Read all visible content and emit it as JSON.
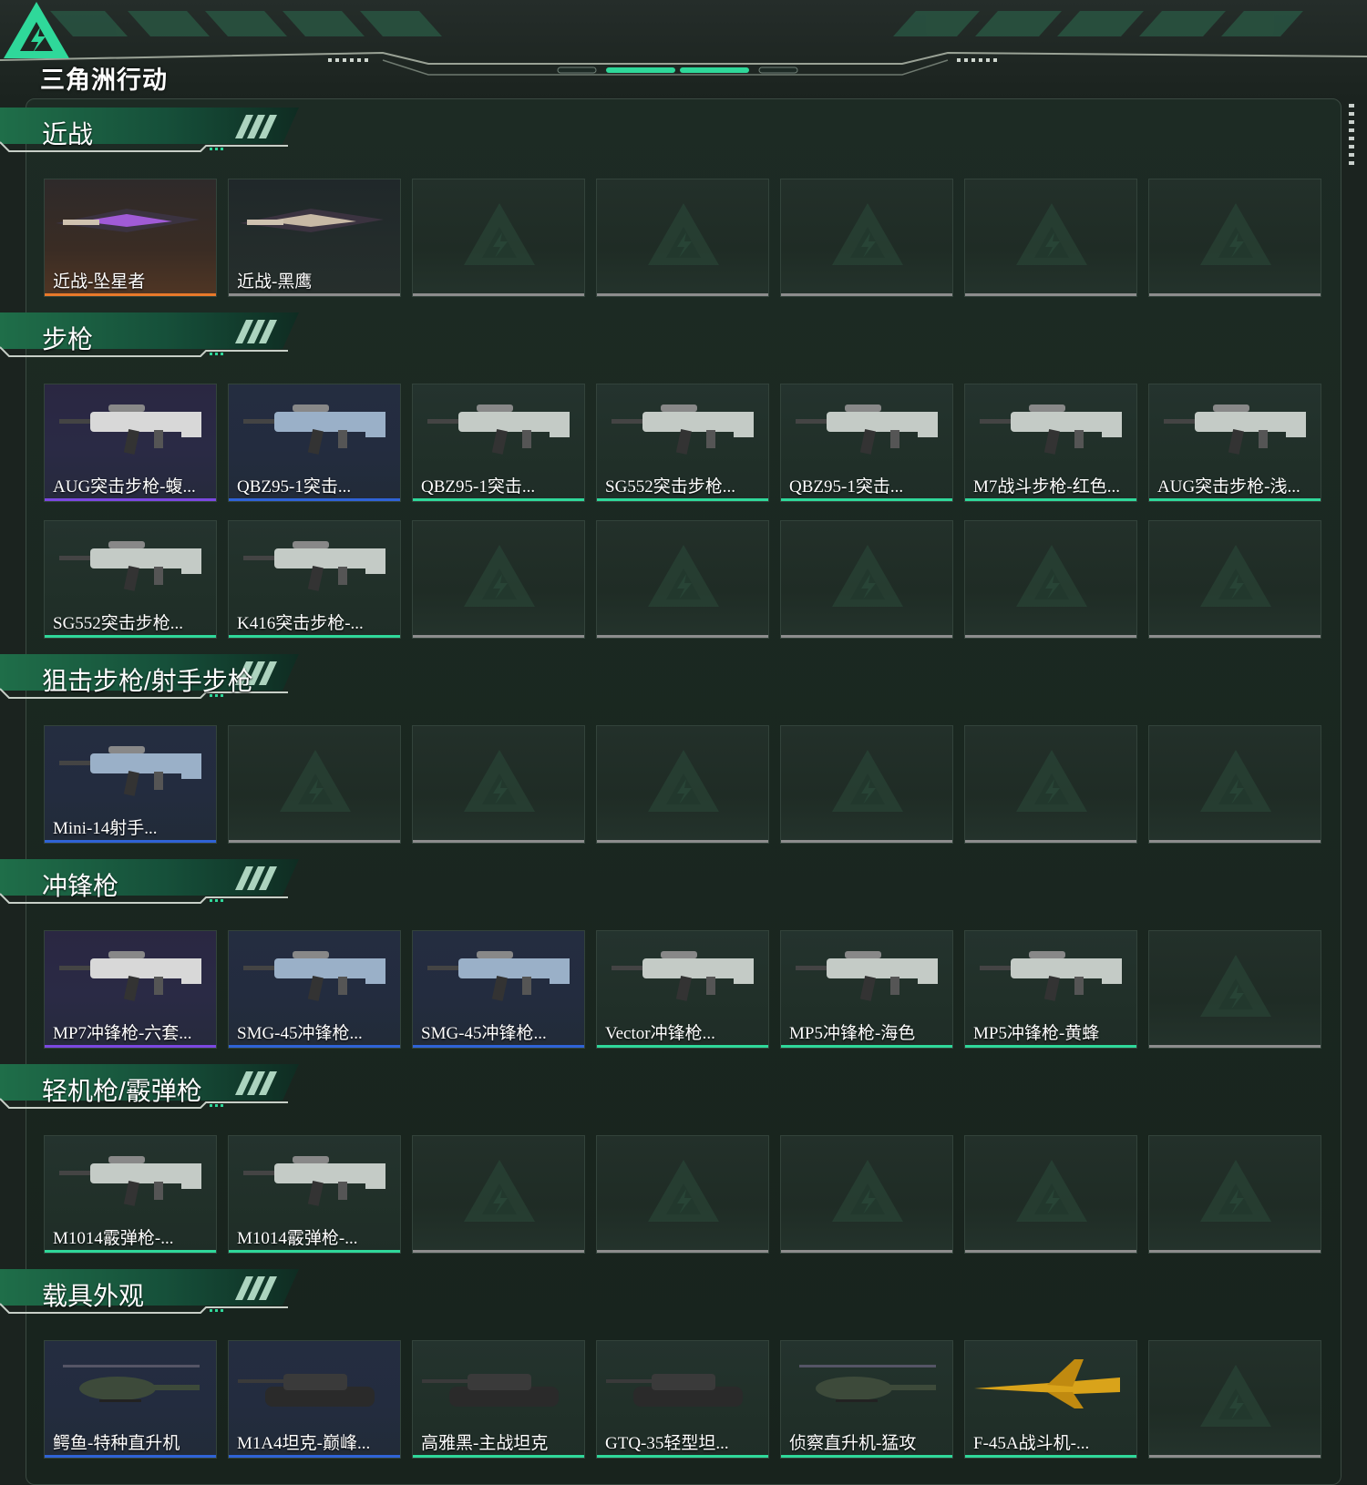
{
  "app": {
    "logo_text": "三角洲行动",
    "accent_color": "#2fd89a"
  },
  "sections": [
    {
      "title": "近战",
      "rows": [
        [
          {
            "label": "近战-坠星者",
            "rarity": "orange",
            "icon": "knife-icon"
          },
          {
            "label": "近战-黑鹰",
            "rarity": "gray",
            "icon": "knife-icon"
          },
          null,
          null,
          null,
          null,
          null
        ]
      ]
    },
    {
      "title": "步枪",
      "rows": [
        [
          {
            "label": "AUG突击步枪-蝮...",
            "rarity": "purple",
            "icon": "rifle-icon"
          },
          {
            "label": "QBZ95-1突击...",
            "rarity": "blue",
            "icon": "rifle-icon"
          },
          {
            "label": "QBZ95-1突击...",
            "rarity": "green",
            "icon": "rifle-icon"
          },
          {
            "label": "SG552突击步枪...",
            "rarity": "green",
            "icon": "rifle-icon"
          },
          {
            "label": "QBZ95-1突击...",
            "rarity": "green",
            "icon": "rifle-icon"
          },
          {
            "label": "M7战斗步枪-红色...",
            "rarity": "green",
            "icon": "rifle-icon"
          },
          {
            "label": "AUG突击步枪-浅...",
            "rarity": "green",
            "icon": "rifle-icon"
          }
        ],
        [
          {
            "label": "SG552突击步枪...",
            "rarity": "green",
            "icon": "rifle-icon"
          },
          {
            "label": "K416突击步枪-...",
            "rarity": "green",
            "icon": "rifle-icon"
          },
          null,
          null,
          null,
          null,
          null
        ]
      ]
    },
    {
      "title": "狙击步枪/射手步枪",
      "rows": [
        [
          {
            "label": "Mini-14射手...",
            "rarity": "blue",
            "icon": "sniper-rifle-icon"
          },
          null,
          null,
          null,
          null,
          null,
          null
        ]
      ]
    },
    {
      "title": "冲锋枪",
      "rows": [
        [
          {
            "label": "MP7冲锋枪-六套...",
            "rarity": "purple",
            "icon": "smg-icon"
          },
          {
            "label": "SMG-45冲锋枪...",
            "rarity": "blue",
            "icon": "smg-icon"
          },
          {
            "label": "SMG-45冲锋枪...",
            "rarity": "blue",
            "icon": "smg-icon"
          },
          {
            "label": "Vector冲锋枪...",
            "rarity": "green",
            "icon": "smg-icon"
          },
          {
            "label": "MP5冲锋枪-海色",
            "rarity": "green",
            "icon": "smg-icon"
          },
          {
            "label": "MP5冲锋枪-黄蜂",
            "rarity": "green",
            "icon": "smg-icon"
          },
          null
        ]
      ]
    },
    {
      "title": "轻机枪/霰弹枪",
      "rows": [
        [
          {
            "label": "M1014霰弹枪-...",
            "rarity": "green",
            "icon": "shotgun-icon"
          },
          {
            "label": "M1014霰弹枪-...",
            "rarity": "green",
            "icon": "shotgun-icon"
          },
          null,
          null,
          null,
          null,
          null
        ]
      ]
    },
    {
      "title": "载具外观",
      "rows": [
        [
          {
            "label": "鳄鱼-特种直升机",
            "rarity": "blue",
            "icon": "helicopter-icon"
          },
          {
            "label": "M1A4坦克-巅峰...",
            "rarity": "blue",
            "icon": "tank-icon"
          },
          {
            "label": "高雅黑-主战坦克",
            "rarity": "green",
            "icon": "tank-icon"
          },
          {
            "label": "GTQ-35轻型坦...",
            "rarity": "green",
            "icon": "tank-icon"
          },
          {
            "label": "侦察直升机-猛攻",
            "rarity": "green",
            "icon": "helicopter-icon"
          },
          {
            "label": "F-45A战斗机-...",
            "rarity": "green",
            "icon": "jet-icon"
          },
          null
        ]
      ]
    }
  ],
  "rarity_colors": {
    "orange": "#e8792a",
    "purple": "#7b48e0",
    "blue": "#2f63d6",
    "green": "#2fd89a",
    "gray": "#8d8d8d",
    "empty": "#8d8d8d"
  }
}
